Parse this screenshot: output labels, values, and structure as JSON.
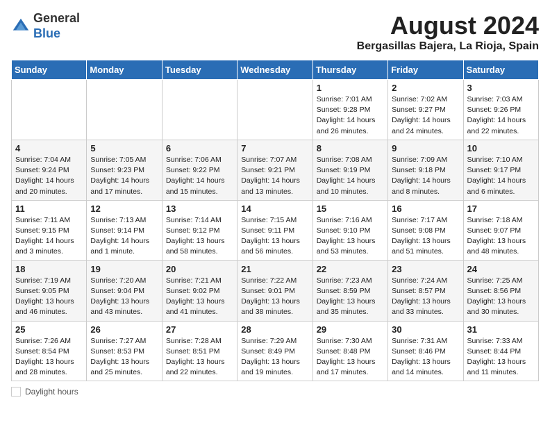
{
  "header": {
    "title": "August 2024",
    "location": "Bergasillas Bajera, La Rioja, Spain",
    "logo_general": "General",
    "logo_blue": "Blue"
  },
  "days_of_week": [
    "Sunday",
    "Monday",
    "Tuesday",
    "Wednesday",
    "Thursday",
    "Friday",
    "Saturday"
  ],
  "weeks": [
    [
      {
        "day": "",
        "info": ""
      },
      {
        "day": "",
        "info": ""
      },
      {
        "day": "",
        "info": ""
      },
      {
        "day": "",
        "info": ""
      },
      {
        "day": "1",
        "info": "Sunrise: 7:01 AM\nSunset: 9:28 PM\nDaylight: 14 hours and 26 minutes."
      },
      {
        "day": "2",
        "info": "Sunrise: 7:02 AM\nSunset: 9:27 PM\nDaylight: 14 hours and 24 minutes."
      },
      {
        "day": "3",
        "info": "Sunrise: 7:03 AM\nSunset: 9:26 PM\nDaylight: 14 hours and 22 minutes."
      }
    ],
    [
      {
        "day": "4",
        "info": "Sunrise: 7:04 AM\nSunset: 9:24 PM\nDaylight: 14 hours and 20 minutes."
      },
      {
        "day": "5",
        "info": "Sunrise: 7:05 AM\nSunset: 9:23 PM\nDaylight: 14 hours and 17 minutes."
      },
      {
        "day": "6",
        "info": "Sunrise: 7:06 AM\nSunset: 9:22 PM\nDaylight: 14 hours and 15 minutes."
      },
      {
        "day": "7",
        "info": "Sunrise: 7:07 AM\nSunset: 9:21 PM\nDaylight: 14 hours and 13 minutes."
      },
      {
        "day": "8",
        "info": "Sunrise: 7:08 AM\nSunset: 9:19 PM\nDaylight: 14 hours and 10 minutes."
      },
      {
        "day": "9",
        "info": "Sunrise: 7:09 AM\nSunset: 9:18 PM\nDaylight: 14 hours and 8 minutes."
      },
      {
        "day": "10",
        "info": "Sunrise: 7:10 AM\nSunset: 9:17 PM\nDaylight: 14 hours and 6 minutes."
      }
    ],
    [
      {
        "day": "11",
        "info": "Sunrise: 7:11 AM\nSunset: 9:15 PM\nDaylight: 14 hours and 3 minutes."
      },
      {
        "day": "12",
        "info": "Sunrise: 7:13 AM\nSunset: 9:14 PM\nDaylight: 14 hours and 1 minute."
      },
      {
        "day": "13",
        "info": "Sunrise: 7:14 AM\nSunset: 9:12 PM\nDaylight: 13 hours and 58 minutes."
      },
      {
        "day": "14",
        "info": "Sunrise: 7:15 AM\nSunset: 9:11 PM\nDaylight: 13 hours and 56 minutes."
      },
      {
        "day": "15",
        "info": "Sunrise: 7:16 AM\nSunset: 9:10 PM\nDaylight: 13 hours and 53 minutes."
      },
      {
        "day": "16",
        "info": "Sunrise: 7:17 AM\nSunset: 9:08 PM\nDaylight: 13 hours and 51 minutes."
      },
      {
        "day": "17",
        "info": "Sunrise: 7:18 AM\nSunset: 9:07 PM\nDaylight: 13 hours and 48 minutes."
      }
    ],
    [
      {
        "day": "18",
        "info": "Sunrise: 7:19 AM\nSunset: 9:05 PM\nDaylight: 13 hours and 46 minutes."
      },
      {
        "day": "19",
        "info": "Sunrise: 7:20 AM\nSunset: 9:04 PM\nDaylight: 13 hours and 43 minutes."
      },
      {
        "day": "20",
        "info": "Sunrise: 7:21 AM\nSunset: 9:02 PM\nDaylight: 13 hours and 41 minutes."
      },
      {
        "day": "21",
        "info": "Sunrise: 7:22 AM\nSunset: 9:01 PM\nDaylight: 13 hours and 38 minutes."
      },
      {
        "day": "22",
        "info": "Sunrise: 7:23 AM\nSunset: 8:59 PM\nDaylight: 13 hours and 35 minutes."
      },
      {
        "day": "23",
        "info": "Sunrise: 7:24 AM\nSunset: 8:57 PM\nDaylight: 13 hours and 33 minutes."
      },
      {
        "day": "24",
        "info": "Sunrise: 7:25 AM\nSunset: 8:56 PM\nDaylight: 13 hours and 30 minutes."
      }
    ],
    [
      {
        "day": "25",
        "info": "Sunrise: 7:26 AM\nSunset: 8:54 PM\nDaylight: 13 hours and 28 minutes."
      },
      {
        "day": "26",
        "info": "Sunrise: 7:27 AM\nSunset: 8:53 PM\nDaylight: 13 hours and 25 minutes."
      },
      {
        "day": "27",
        "info": "Sunrise: 7:28 AM\nSunset: 8:51 PM\nDaylight: 13 hours and 22 minutes."
      },
      {
        "day": "28",
        "info": "Sunrise: 7:29 AM\nSunset: 8:49 PM\nDaylight: 13 hours and 19 minutes."
      },
      {
        "day": "29",
        "info": "Sunrise: 7:30 AM\nSunset: 8:48 PM\nDaylight: 13 hours and 17 minutes."
      },
      {
        "day": "30",
        "info": "Sunrise: 7:31 AM\nSunset: 8:46 PM\nDaylight: 13 hours and 14 minutes."
      },
      {
        "day": "31",
        "info": "Sunrise: 7:33 AM\nSunset: 8:44 PM\nDaylight: 13 hours and 11 minutes."
      }
    ]
  ],
  "footer": {
    "daylight_label": "Daylight hours"
  }
}
